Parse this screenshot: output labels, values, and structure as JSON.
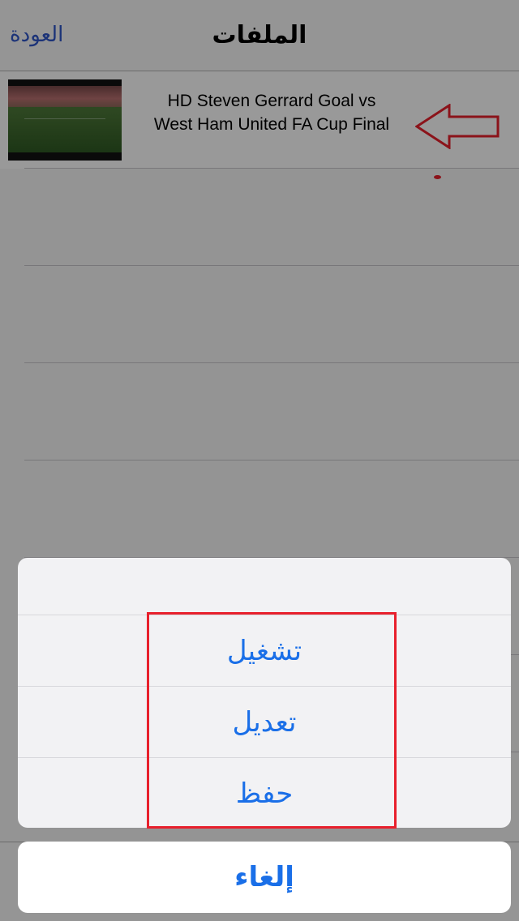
{
  "nav": {
    "title": "الملفات",
    "back_label": "العودة"
  },
  "files": [
    {
      "title_line1": "HD  Steven Gerrard Goal vs",
      "title_line2": "West Ham United FA Cup Final"
    }
  ],
  "action_sheet": {
    "options": [
      {
        "label": "تشغيل"
      },
      {
        "label": "تعديل"
      },
      {
        "label": "حفظ"
      }
    ],
    "cancel_label": "إلغاء"
  },
  "colors": {
    "accent": "#1a6fe8",
    "annotation": "#e8202c",
    "back_link": "#2f56c8"
  },
  "icons": {
    "annotation": "arrow-left-outline-icon"
  }
}
